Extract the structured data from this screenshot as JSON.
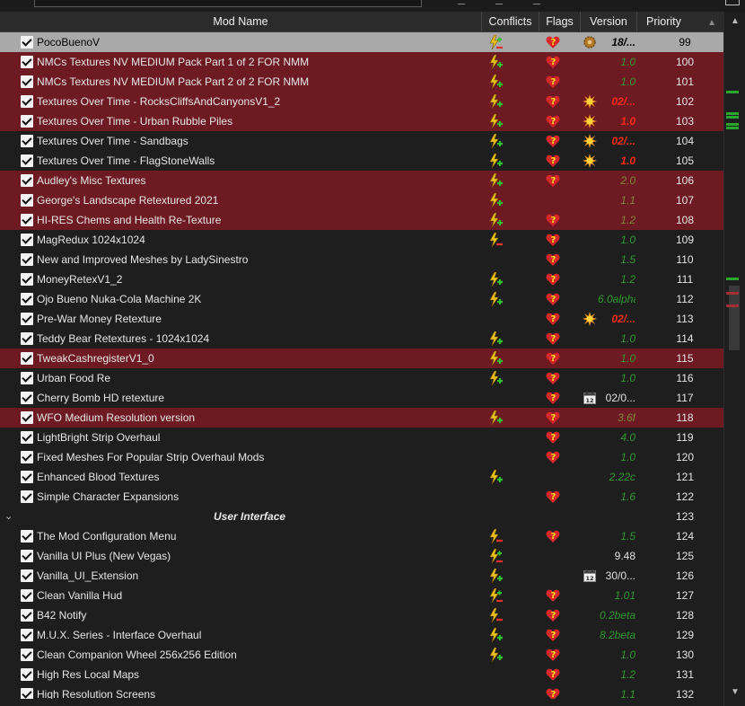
{
  "columns": {
    "name": "Mod Name",
    "conflicts": "Conflicts",
    "flags": "Flags",
    "version": "Version",
    "priority": "Priority"
  },
  "colors": {
    "conflict_row": "#6e1a22",
    "selected_row": "#a9a9a9",
    "version_ok": "#2f9a2f",
    "version_alert": "#ff2a1a"
  },
  "rows": [
    {
      "name": "PocoBuenoV",
      "version": "18/...",
      "priority": "99",
      "selected": true,
      "conflict": "bolt-plus-minus",
      "flag": "heart-question",
      "vicon": "gear",
      "vstyle": "sel-bold"
    },
    {
      "name": "NMCs Textures NV MEDIUM Pack Part 1 of 2 FOR NMM",
      "version": "1.0",
      "priority": "100",
      "highlight": true,
      "conflict": "bolt-plus",
      "flag": "heart-question"
    },
    {
      "name": "NMCs Textures NV MEDIUM Pack Part 2 of 2 FOR NMM",
      "version": "1.0",
      "priority": "101",
      "highlight": true,
      "conflict": "bolt-plus",
      "flag": "heart-question"
    },
    {
      "name": "Textures Over Time - RocksCliffsAndCanyonsV1_2",
      "version": "02/...",
      "priority": "102",
      "highlight": true,
      "conflict": "bolt-plus",
      "flag": "heart-question",
      "vicon": "sun",
      "vstyle": "red"
    },
    {
      "name": "Textures Over Time - Urban Rubble Piles",
      "version": "1.0",
      "priority": "103",
      "highlight": true,
      "conflict": "bolt-plus",
      "flag": "heart-question",
      "vicon": "sun",
      "vstyle": "red"
    },
    {
      "name": "Textures Over Time - Sandbags",
      "version": "02/...",
      "priority": "104",
      "conflict": "bolt-plus",
      "flag": "heart-question",
      "vicon": "sun",
      "vstyle": "red"
    },
    {
      "name": "Textures Over Time - FlagStoneWalls",
      "version": "1.0",
      "priority": "105",
      "conflict": "bolt-plus",
      "flag": "heart-question",
      "vicon": "sun",
      "vstyle": "red"
    },
    {
      "name": "Audley's Misc Textures",
      "version": "2.0",
      "priority": "106",
      "highlight": true,
      "conflict": "bolt-plus",
      "flag": "heart-question",
      "vstyle": "dim"
    },
    {
      "name": "George's Landscape Retextured 2021",
      "version": "1.1",
      "priority": "107",
      "highlight": true,
      "conflict": "bolt-plus",
      "vstyle": "dim"
    },
    {
      "name": "HI-RES Chems and Health Re-Texture",
      "version": "1.2",
      "priority": "108",
      "highlight": true,
      "conflict": "bolt-plus",
      "flag": "heart-question",
      "vstyle": "dim"
    },
    {
      "name": "MagRedux 1024x1024",
      "version": "1.0",
      "priority": "109",
      "conflict": "bolt-minus",
      "flag": "heart-question"
    },
    {
      "name": "New and Improved Meshes by LadySinestro",
      "version": "1.5",
      "priority": "110",
      "flag": "heart-question"
    },
    {
      "name": "MoneyRetexV1_2",
      "version": "1.2",
      "priority": "111",
      "conflict": "bolt-plus",
      "flag": "heart-question"
    },
    {
      "name": "Ojo Bueno Nuka-Cola Machine 2K",
      "version": "6.0alpha",
      "priority": "112",
      "conflict": "bolt-plus",
      "flag": "heart-question"
    },
    {
      "name": "Pre-War Money Retexture",
      "version": "02/...",
      "priority": "113",
      "flag": "heart-question",
      "vicon": "sun",
      "vstyle": "red"
    },
    {
      "name": "Teddy Bear Retextures - 1024x1024",
      "version": "1.0",
      "priority": "114",
      "conflict": "bolt-plus",
      "flag": "heart-question"
    },
    {
      "name": "TweakCashregisterV1_0",
      "version": "1.0",
      "priority": "115",
      "highlight": true,
      "conflict": "bolt-plus",
      "flag": "heart-question"
    },
    {
      "name": "Urban Food Re",
      "version": "1.0",
      "priority": "116",
      "conflict": "bolt-plus",
      "flag": "heart-question"
    },
    {
      "name": "Cherry Bomb HD retexture",
      "version": "02/0...",
      "priority": "117",
      "flag": "heart-question",
      "vicon": "calendar",
      "vstyle": "plain"
    },
    {
      "name": "WFO Medium Resolution version",
      "version": "3.6f",
      "priority": "118",
      "highlight": true,
      "conflict": "bolt-plus",
      "flag": "heart-question",
      "vstyle": "dim"
    },
    {
      "name": "LightBright Strip Overhaul",
      "version": "4.0",
      "priority": "119",
      "flag": "heart-question"
    },
    {
      "name": "Fixed Meshes For Popular Strip Overhaul Mods",
      "version": "1.0",
      "priority": "120",
      "flag": "heart-question"
    },
    {
      "name": "Enhanced Blood Textures",
      "version": "2.22c",
      "priority": "121",
      "conflict": "bolt-plus"
    },
    {
      "name": "Simple Character Expansions",
      "version": "1.6",
      "priority": "122",
      "flag": "heart-question"
    },
    {
      "group": true,
      "name": "User Interface",
      "priority": "123"
    },
    {
      "name": "The Mod Configuration Menu",
      "version": "1.5",
      "priority": "124",
      "conflict": "bolt-minus",
      "flag": "heart-question"
    },
    {
      "name": "Vanilla UI Plus (New Vegas)",
      "version": "9.48",
      "priority": "125",
      "conflict": "bolt-plus-minus",
      "vstyle": "plain"
    },
    {
      "name": "Vanilla_UI_Extension",
      "version": "30/0...",
      "priority": "126",
      "conflict": "bolt-plus",
      "vicon": "calendar",
      "vstyle": "plain"
    },
    {
      "name": "Clean Vanilla Hud",
      "version": "1.01",
      "priority": "127",
      "conflict": "bolt-plus-minus",
      "flag": "heart-question"
    },
    {
      "name": "B42 Notify",
      "version": "0.2beta",
      "priority": "128",
      "conflict": "bolt-minus",
      "flag": "heart-question"
    },
    {
      "name": "M.U.X. Series - Interface Overhaul",
      "version": "8.2beta",
      "priority": "129",
      "conflict": "bolt-plus",
      "flag": "heart-question"
    },
    {
      "name": "Clean Companion Wheel 256x256 Edition",
      "version": "1.0",
      "priority": "130",
      "conflict": "bolt-plus",
      "flag": "heart-question"
    },
    {
      "name": "High Res Local Maps",
      "version": "1.2",
      "priority": "131",
      "flag": "heart-question"
    },
    {
      "name": "High Resolution Screens",
      "version": "1.1",
      "priority": "132",
      "flag": "heart-question"
    }
  ]
}
